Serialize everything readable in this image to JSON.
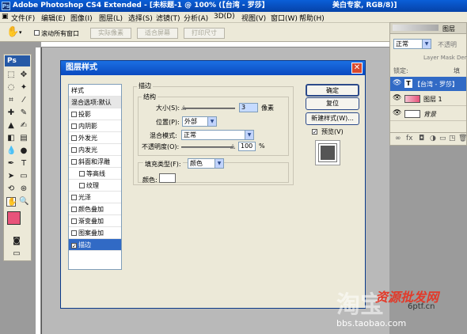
{
  "titlebar": {
    "title": "Adobe Photoshop CS4 Extended - [未标题-1 @ 100% (【台湾 - 罗莎】",
    "right": "美白专家, RGB/8)]"
  },
  "menu": [
    "文件(F)",
    "编辑(E)",
    "图像(I)",
    "图层(L)",
    "选择(S)",
    "滤镜(T)",
    "分析(A)",
    "3D(D)",
    "视图(V)",
    "窗口(W)",
    "帮助(H)"
  ],
  "options": {
    "scroll_all": "滚动所有窗口",
    "btn1": "实际像素",
    "btn2": "适合屏幕",
    "btn3": "打印尺寸"
  },
  "colors": {
    "foreground": "#e8537a",
    "background": "#b6462b"
  },
  "layers_panel": {
    "tab": "图层",
    "blend": "正常",
    "opacity_label": "不透明",
    "mask_hint": "Layer Mask Dens",
    "lock_label": "锁定:",
    "fill_label": "填",
    "layers": [
      {
        "name": "【台湾 - 罗莎】",
        "type": "text"
      },
      {
        "name": "图层 1",
        "type": "pixel"
      },
      {
        "name": "背景",
        "type": "background"
      }
    ]
  },
  "dialog": {
    "title": "图层样式",
    "list_header": "样式",
    "list_items": [
      {
        "label": "混合选项:默认",
        "checkbox": false,
        "checked": false
      },
      {
        "label": "投影",
        "checkbox": true,
        "checked": false
      },
      {
        "label": "内阴影",
        "checkbox": true,
        "checked": false
      },
      {
        "label": "外发光",
        "checkbox": true,
        "checked": false
      },
      {
        "label": "内发光",
        "checkbox": true,
        "checked": false
      },
      {
        "label": "斜面和浮雕",
        "checkbox": true,
        "checked": false
      },
      {
        "label": "等高线",
        "checkbox": true,
        "checked": false
      },
      {
        "label": "纹理",
        "checkbox": true,
        "checked": false
      },
      {
        "label": "光泽",
        "checkbox": true,
        "checked": false
      },
      {
        "label": "颜色叠加",
        "checkbox": true,
        "checked": false
      },
      {
        "label": "渐变叠加",
        "checkbox": true,
        "checked": false
      },
      {
        "label": "图案叠加",
        "checkbox": true,
        "checked": false
      },
      {
        "label": "描边",
        "checkbox": true,
        "checked": true
      }
    ],
    "section": "描边",
    "subsection": "结构",
    "size_label": "大小(S):",
    "size_value": "3",
    "size_unit": "像素",
    "position_label": "位置(P):",
    "position_value": "外部",
    "blend_label": "混合模式:",
    "blend_value": "正常",
    "opacity_label": "不透明度(O):",
    "opacity_value": "100",
    "opacity_unit": "%",
    "fill_type_label": "填充类型(F):",
    "fill_type_value": "颜色",
    "color_label": "颜色:",
    "stroke_color": "#ffffff",
    "ok": "确定",
    "reset": "复位",
    "new_style": "新建样式(W)...",
    "preview": "预览(V)"
  },
  "watermark": {
    "w1": "淘宝",
    "w2": "资源批发网",
    "w3": "6ptf.cn",
    "w4": "bbs.taobao.com"
  }
}
